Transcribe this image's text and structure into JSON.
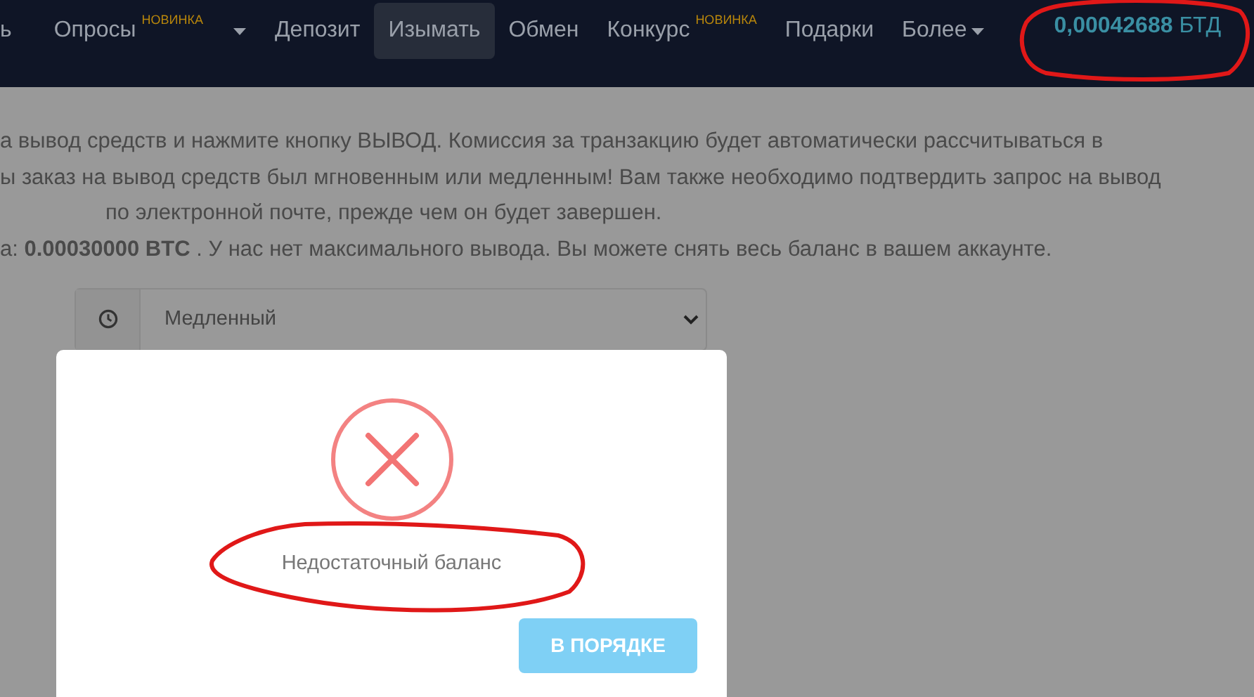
{
  "navbar": {
    "items": [
      {
        "label": "ь",
        "selected": false
      },
      {
        "label": "Опросы",
        "badge": "НОВИНКА",
        "dropdown": true,
        "selected": false
      },
      {
        "label": "Депозит",
        "selected": false
      },
      {
        "label": "Изымать",
        "selected": true
      },
      {
        "label": "Обмен",
        "selected": false
      },
      {
        "label": "Конкурс",
        "badge": "НОВИНКА",
        "selected": false
      },
      {
        "label": "Подарки",
        "selected": false
      },
      {
        "label": "Более",
        "dropdown": true,
        "selected": false
      }
    ],
    "balance": {
      "amount": "0,00042688",
      "currency": "БТД"
    }
  },
  "instructions": [
    {
      "text": "а вывод средств и нажмите кнопку ВЫВОД. Комиссия за транзакцию будет автоматически рассчитываться в"
    },
    {
      "text": "ы заказ на вывод средств был мгновенным или медленным! Вам также необходимо подтвердить запрос на вывод"
    },
    {
      "text": "по электронной почте, прежде чем он будет завершен.",
      "indented": true
    },
    {
      "text": "а: **0.00030000 BTC** . У нас нет максимального вывода. Вы можете снять весь баланс в вашем аккаунте."
    }
  ],
  "speed_select": {
    "value": "Медленный"
  },
  "dialog": {
    "message": "Недостаточный баланс",
    "button": "В ПОРЯДКЕ"
  }
}
